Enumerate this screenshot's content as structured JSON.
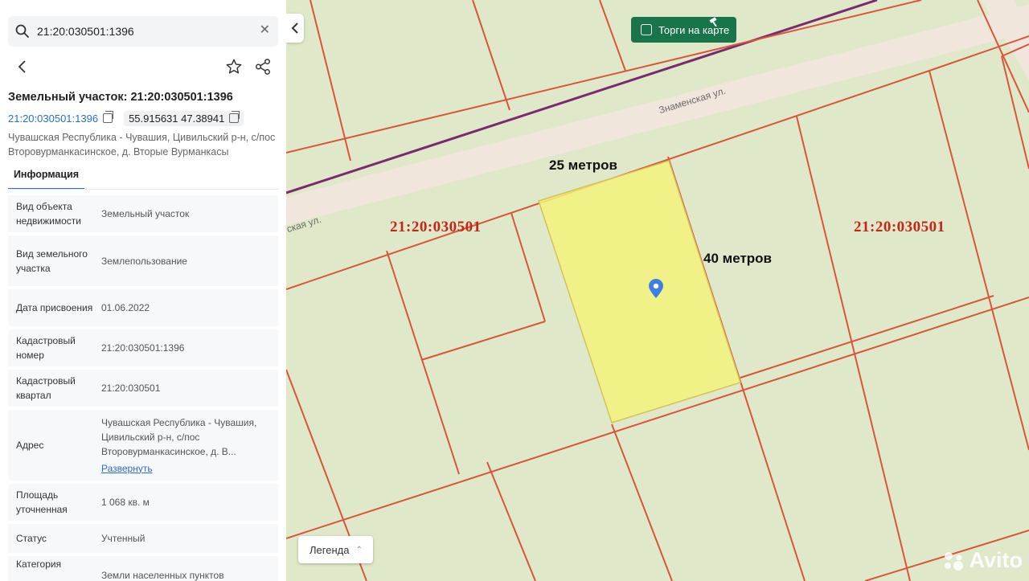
{
  "search": {
    "value": "21:20:030501:1396"
  },
  "parcel": {
    "title": "Земельный участок: 21:20:030501:1396",
    "cadastral_link": "21:20:030501:1396",
    "coords": "55.915631 47.38941",
    "address": "Чувашская Республика - Чувашия, Цивильский р-н, с/пос Второвурманкасинское, д. Вторые Вурманкасы"
  },
  "tabs": {
    "info": "Информация"
  },
  "info_rows": [
    {
      "key": "Вид объекта недвижимости",
      "value": "Земельный участок"
    },
    {
      "key": "Вид земельного участка",
      "value": "Землепользование"
    },
    {
      "key": "Дата присвоения",
      "value": "01.06.2022"
    },
    {
      "key": "Кадастровый номер",
      "value": "21:20:030501:1396"
    },
    {
      "key": "Кадастровый квартал",
      "value": "21:20:030501"
    },
    {
      "key": "Адрес",
      "value": "Чувашская Республика - Чувашия, Цивильский р-н, с/пос Второвурманкасинское, д. В...",
      "link": "Развернуть"
    },
    {
      "key": "Площадь уточненная",
      "value": "1 068 кв. м"
    },
    {
      "key": "Статус",
      "value": "Учтенный"
    },
    {
      "key": "Категория",
      "value": "Земли населенных пунктов"
    }
  ],
  "map": {
    "torgi_label": "Торги на карте",
    "legend_label": "Легенда",
    "street_1": "Знаменская ул.",
    "street_2": "ская ул.",
    "quarter_left": "21:20:030501",
    "quarter_right": "21:20:030501",
    "width_label": "25 метров",
    "length_label": "40 метров",
    "watermark": "Avito"
  },
  "colors": {
    "accent": "#2b6cd6",
    "torgi": "#18754a",
    "boundary": "#d9553b",
    "highlight": "#f3f27a",
    "road": "#7a2a6e"
  }
}
